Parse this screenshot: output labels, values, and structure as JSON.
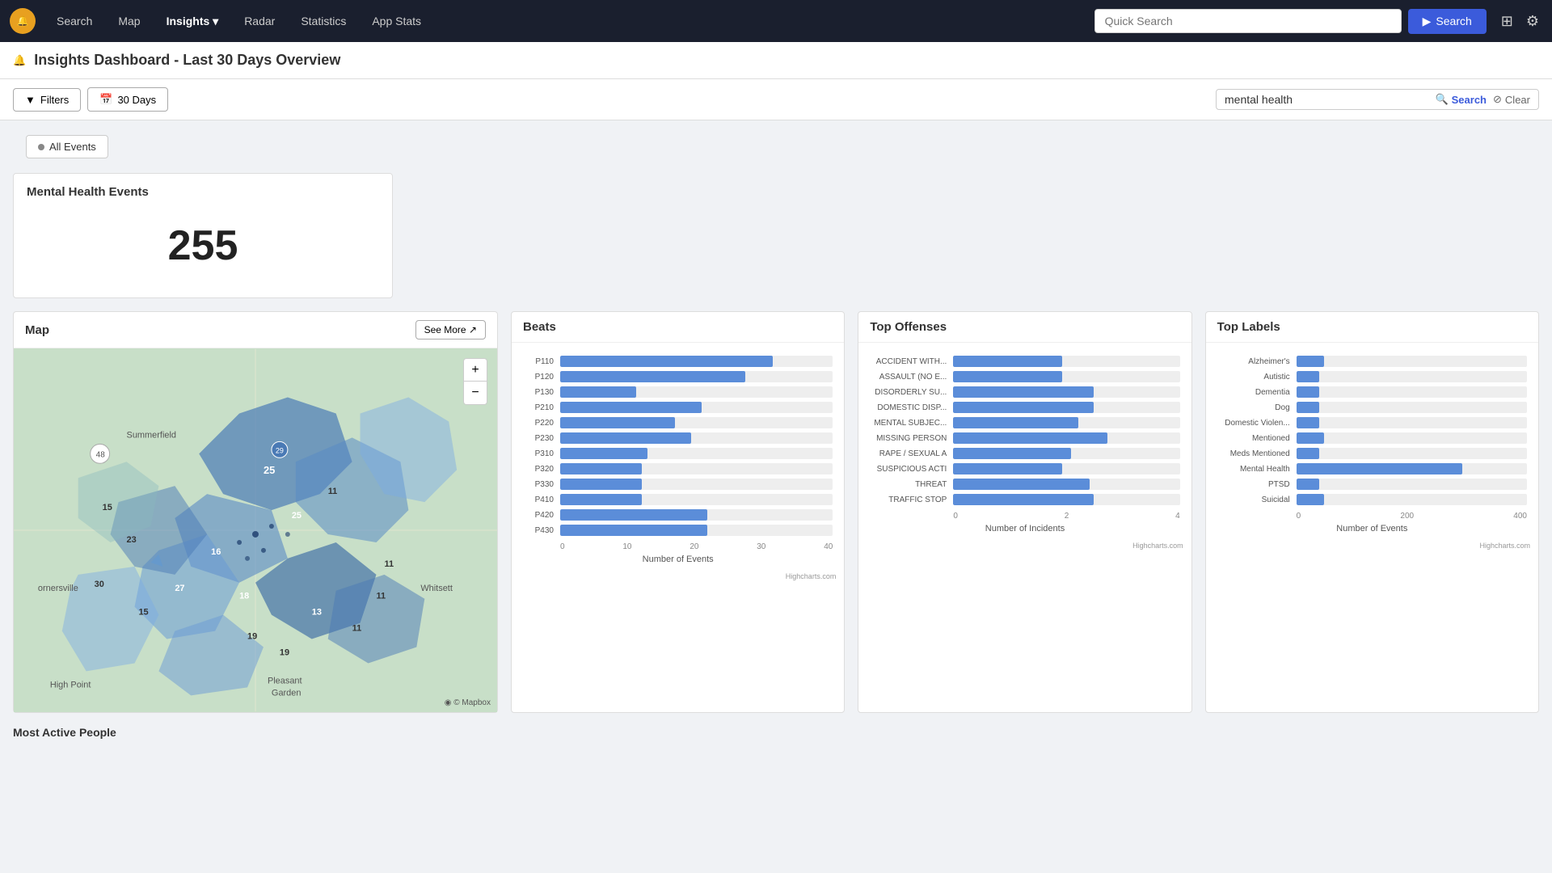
{
  "nav": {
    "logo_text": "🔔",
    "items": [
      {
        "label": "Search",
        "active": false
      },
      {
        "label": "Map",
        "active": false
      },
      {
        "label": "Insights",
        "active": true,
        "has_dropdown": true
      },
      {
        "label": "Radar",
        "active": false
      },
      {
        "label": "Statistics",
        "active": false
      },
      {
        "label": "App Stats",
        "active": false
      }
    ],
    "quick_search_placeholder": "Quick Search",
    "search_btn_label": "Search"
  },
  "page": {
    "title": "Insights Dashboard - Last 30 Days Overview",
    "title_icon": "🔔"
  },
  "toolbar": {
    "filters_label": "Filters",
    "days_label": "30 Days",
    "search_value": "mental health",
    "search_btn_label": "Search",
    "clear_btn_label": "Clear"
  },
  "events_tag": {
    "label": "All Events"
  },
  "stats_card": {
    "title": "Mental Health Events",
    "count": "255"
  },
  "map_panel": {
    "title": "Map",
    "see_more_label": "See More ↗",
    "zoom_plus": "+",
    "zoom_minus": "−",
    "mapbox_label": "© Mapbox"
  },
  "beats_chart": {
    "title": "Beats",
    "bars": [
      {
        "label": "P110",
        "value": 78
      },
      {
        "label": "P120",
        "value": 68
      },
      {
        "label": "P130",
        "value": 28
      },
      {
        "label": "P210",
        "value": 52
      },
      {
        "label": "P220",
        "value": 42
      },
      {
        "label": "P230",
        "value": 48
      },
      {
        "label": "P310",
        "value": 32
      },
      {
        "label": "P320",
        "value": 30
      },
      {
        "label": "P330",
        "value": 30
      },
      {
        "label": "P410",
        "value": 30
      },
      {
        "label": "P420",
        "value": 54
      },
      {
        "label": "P430",
        "value": 54
      }
    ],
    "max": 100,
    "x_ticks": [
      "0",
      "10",
      "20",
      "30",
      "40"
    ],
    "x_title": "Number of Events",
    "attribution": "Highcharts.com"
  },
  "offenses_chart": {
    "title": "Top Offenses",
    "bars": [
      {
        "label": "ACCIDENT WITH...",
        "value": 48
      },
      {
        "label": "ASSAULT (NO E...",
        "value": 48
      },
      {
        "label": "DISORDERLY SU...",
        "value": 62
      },
      {
        "label": "DOMESTIC DISP...",
        "value": 62
      },
      {
        "label": "MENTAL SUBJEC...",
        "value": 55
      },
      {
        "label": "MISSING PERSON",
        "value": 68
      },
      {
        "label": "RAPE / SEXUAL A",
        "value": 52
      },
      {
        "label": "SUSPICIOUS ACTI",
        "value": 48
      },
      {
        "label": "THREAT",
        "value": 60
      },
      {
        "label": "TRAFFIC STOP",
        "value": 62
      }
    ],
    "max": 100,
    "x_ticks": [
      "0",
      "2",
      "4"
    ],
    "x_title": "Number of Incidents",
    "attribution": "Highcharts.com"
  },
  "labels_chart": {
    "title": "Top Labels",
    "bars": [
      {
        "label": "Alzheimer's",
        "value": 12
      },
      {
        "label": "Autistic",
        "value": 10
      },
      {
        "label": "Dementia",
        "value": 10
      },
      {
        "label": "Dog",
        "value": 10
      },
      {
        "label": "Domestic Violen...",
        "value": 10
      },
      {
        "label": "Mentioned",
        "value": 12
      },
      {
        "label": "Meds Mentioned",
        "value": 10
      },
      {
        "label": "Mental Health",
        "value": 72
      },
      {
        "label": "PTSD",
        "value": 10
      },
      {
        "label": "Suicidal",
        "value": 12
      }
    ],
    "max": 100,
    "x_ticks": [
      "0",
      "200",
      "400"
    ],
    "x_title": "Number of Events",
    "attribution": "Highcharts.com"
  },
  "bottom_section": {
    "title": "Most Active People"
  }
}
